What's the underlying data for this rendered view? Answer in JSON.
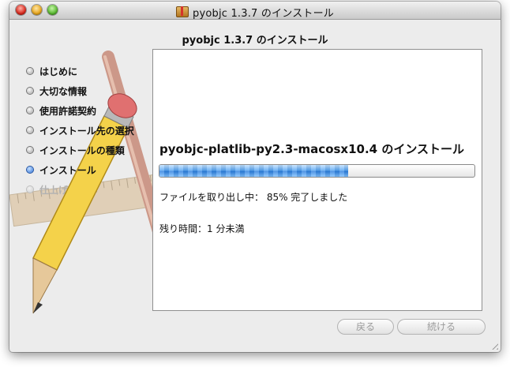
{
  "window": {
    "title": "pyobjc 1.3.7 のインストール",
    "app_icon": "package-icon"
  },
  "header": {
    "title": "pyobjc 1.3.7 のインストール"
  },
  "sidebar": {
    "steps": [
      {
        "label": "はじめに",
        "state": "done"
      },
      {
        "label": "大切な情報",
        "state": "done"
      },
      {
        "label": "使用許諾契約",
        "state": "done"
      },
      {
        "label": "インストール先の選択",
        "state": "done"
      },
      {
        "label": "インストールの種類",
        "state": "done"
      },
      {
        "label": "インストール",
        "state": "active"
      },
      {
        "label": "仕上げ",
        "state": "pending"
      }
    ]
  },
  "main": {
    "install_heading": "pyobjc-platlib-py2.3-macosx10.4 のインストール",
    "progress": {
      "fraction": 0.6,
      "accent": "#2d7fde"
    },
    "status_text": "ファイルを取り出し中： 85% 完了しました",
    "time_remaining": "残り時間：1 分未満"
  },
  "footer": {
    "back_label": "戻る",
    "continue_label": "続ける"
  }
}
